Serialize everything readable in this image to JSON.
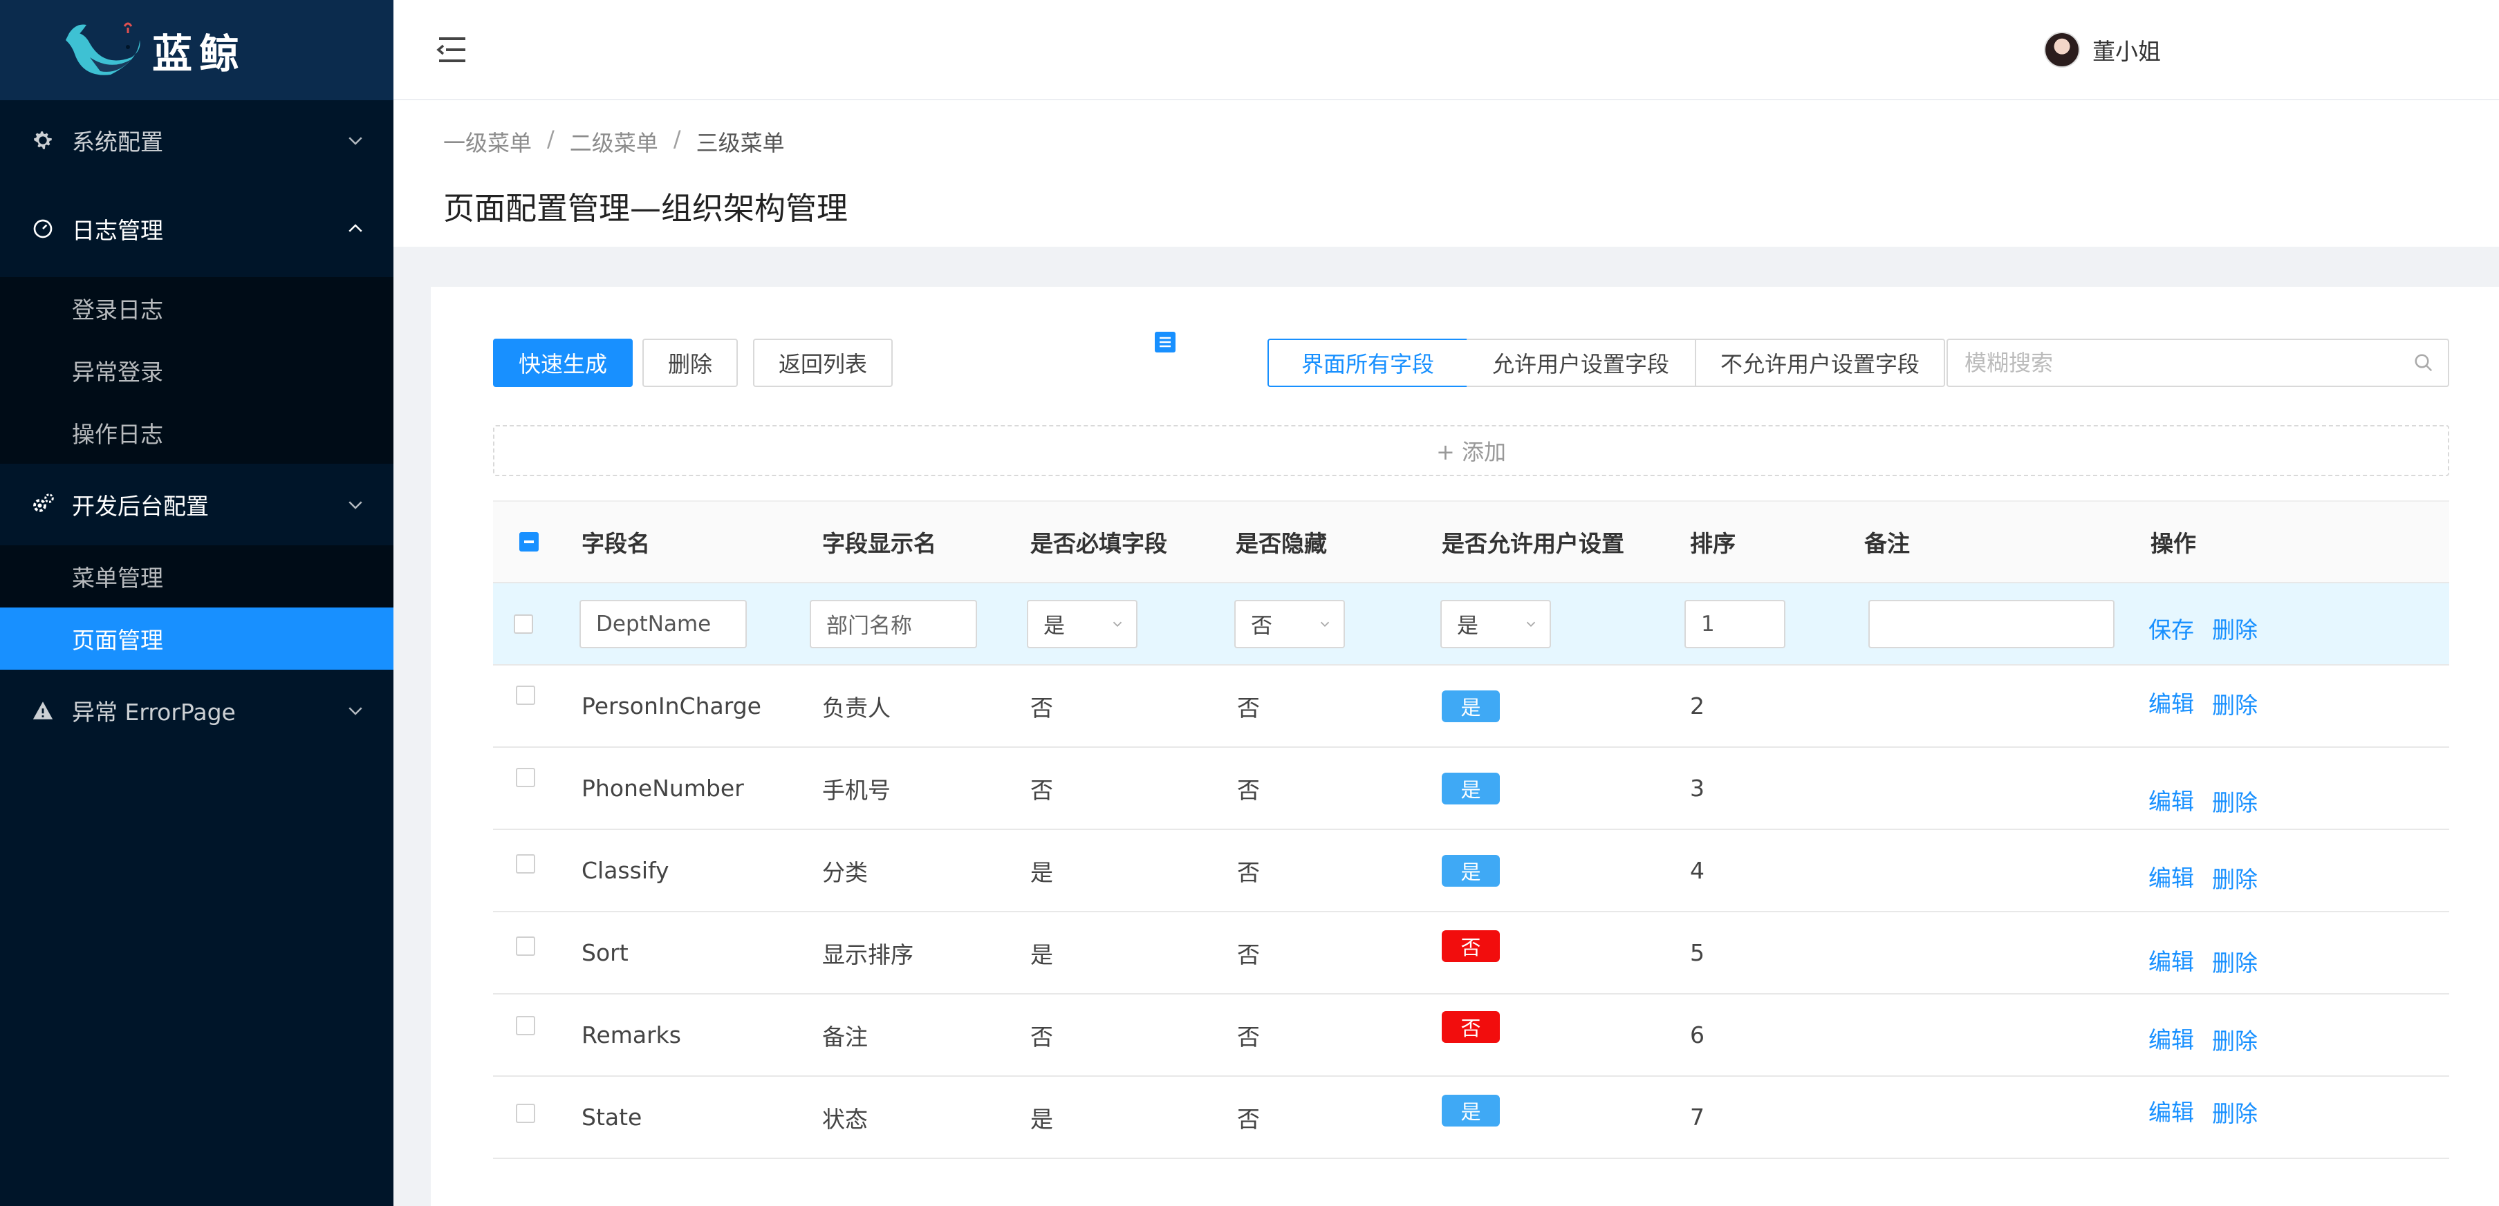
{
  "app": {
    "logo_text": "蓝鲸"
  },
  "sidebar": {
    "groups": [
      {
        "label": "系统配置"
      },
      {
        "label": "日志管理",
        "children": [
          "登录日志",
          "异常登录",
          "操作日志"
        ]
      },
      {
        "label": "开发后台配置",
        "children": [
          "菜单管理",
          "页面管理"
        ]
      },
      {
        "label": "异常 ErrorPage"
      }
    ]
  },
  "header": {
    "user_name": "董小姐"
  },
  "breadcrumb": [
    "一级菜单",
    "二级菜单",
    "三级菜单"
  ],
  "breadcrumb_separator": "/",
  "page_title": "页面配置管理—组织架构管理",
  "toolbar": {
    "quick_generate": "快速生成",
    "delete": "删除",
    "back": "返回列表",
    "filters": [
      "界面所有字段",
      "允许用户设置字段",
      "不允许用户设置字段"
    ],
    "search_placeholder": "模糊搜索",
    "add_label": "+ 添加"
  },
  "table": {
    "headers": [
      "字段名",
      "字段显示名",
      "是否必填字段",
      "是否隐藏",
      "是否允许用户设置",
      "排序",
      "备注",
      "操作"
    ],
    "edit_row": {
      "field_name": "DeptName",
      "display_name": "部门名称",
      "required": "是",
      "hidden": "否",
      "user_settable": "是",
      "sort": "1",
      "remark": "",
      "save": "保存",
      "delete": "删除"
    },
    "rows": [
      {
        "field_name": "PersonInCharge",
        "display_name": "负责人",
        "required": "否",
        "hidden": "否",
        "user_settable": "是",
        "sort": "2"
      },
      {
        "field_name": "PhoneNumber",
        "display_name": "手机号",
        "required": "否",
        "hidden": "否",
        "user_settable": "是",
        "sort": "3"
      },
      {
        "field_name": "Classify",
        "display_name": "分类",
        "required": "是",
        "hidden": "否",
        "user_settable": "是",
        "sort": "4"
      },
      {
        "field_name": "Sort",
        "display_name": "显示排序",
        "required": "是",
        "hidden": "否",
        "user_settable": "否",
        "sort": "5"
      },
      {
        "field_name": "Remarks",
        "display_name": "备注",
        "required": "否",
        "hidden": "否",
        "user_settable": "否",
        "sort": "6"
      },
      {
        "field_name": "State",
        "display_name": "状态",
        "required": "是",
        "hidden": "否",
        "user_settable": "是",
        "sort": "7"
      }
    ],
    "row_actions": {
      "edit": "编辑",
      "delete": "删除"
    }
  },
  "colors": {
    "primary": "#1890ff",
    "sidebar": "#001529",
    "tag_yes": "#3fa9f5",
    "tag_no": "#f20d0d"
  }
}
